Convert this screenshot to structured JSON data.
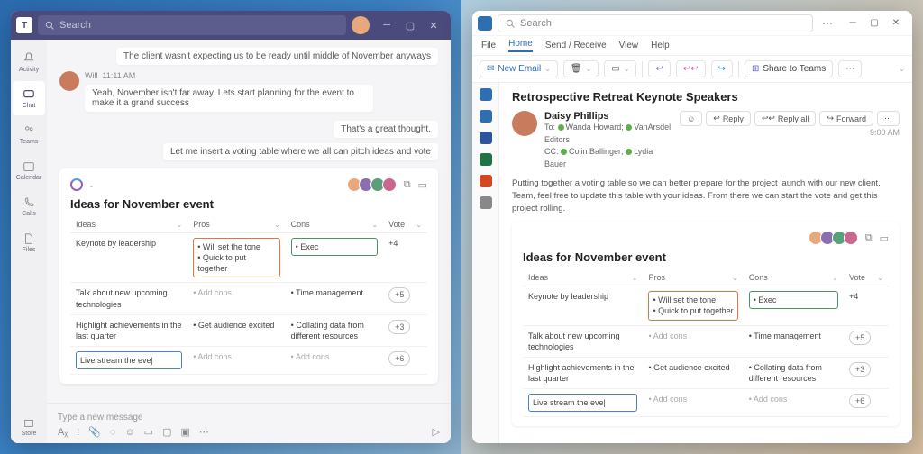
{
  "teams": {
    "search_placeholder": "Search",
    "rail": [
      "Activity",
      "Chat",
      "Teams",
      "Calendar",
      "Calls",
      "Files",
      "Store"
    ],
    "context_msg": "The client wasn't expecting us to be ready until middle of November anyways",
    "sender": "Will",
    "time": "11:11 AM",
    "msg1": "Yeah, November isn't far away. Lets start planning for the event to make it a grand success",
    "reply1": "That's a great thought.",
    "reply2": "Let me insert a voting table where we all can pitch ideas and vote",
    "compose_placeholder": "Type a new message"
  },
  "loop": {
    "title": "Ideas for November event",
    "cols": {
      "ideas": "Ideas",
      "pros": "Pros",
      "cons": "Cons",
      "vote": "Vote"
    },
    "rows": [
      {
        "idea": "Keynote by leadership",
        "pros": [
          "Will set the tone",
          "Quick to put together"
        ],
        "cons": [
          "Exec"
        ],
        "vote": "+4",
        "box": true
      },
      {
        "idea": "Talk about new upcoming technologies",
        "pros_add": "Add cons",
        "cons": [
          "Time management"
        ],
        "vote": "+5"
      },
      {
        "idea": "Highlight achievements in the last quarter",
        "pros": [
          "Get audience excited"
        ],
        "cons": [
          "Collating data from different resources"
        ],
        "vote": "+3"
      },
      {
        "idea": "Live stream the eve",
        "pros_add": "Add cons",
        "cons_add": "Add cons",
        "vote": "+6",
        "editing": true
      }
    ]
  },
  "outlook": {
    "search_placeholder": "Search",
    "menus": [
      "File",
      "Home",
      "Send / Receive",
      "View",
      "Help"
    ],
    "ribbon": {
      "new": "New Email",
      "share": "Share to Teams"
    },
    "subject": "Retrospective Retreat Keynote Speakers",
    "from": "Daisy Phillips",
    "to_label": "To:",
    "to": [
      "Wanda Howard",
      "VanArsdel Editors"
    ],
    "cc_label": "CC:",
    "cc": [
      "Colin Ballinger",
      "Lydia Bauer"
    ],
    "time": "9:00 AM",
    "actions": {
      "reply": "Reply",
      "replyall": "Reply all",
      "forward": "Forward"
    },
    "body": "Putting together a voting table so we can better prepare for the project launch with our new client. Team, feel free to update this table with your ideas. From there we can start the vote and get this project rolling."
  }
}
